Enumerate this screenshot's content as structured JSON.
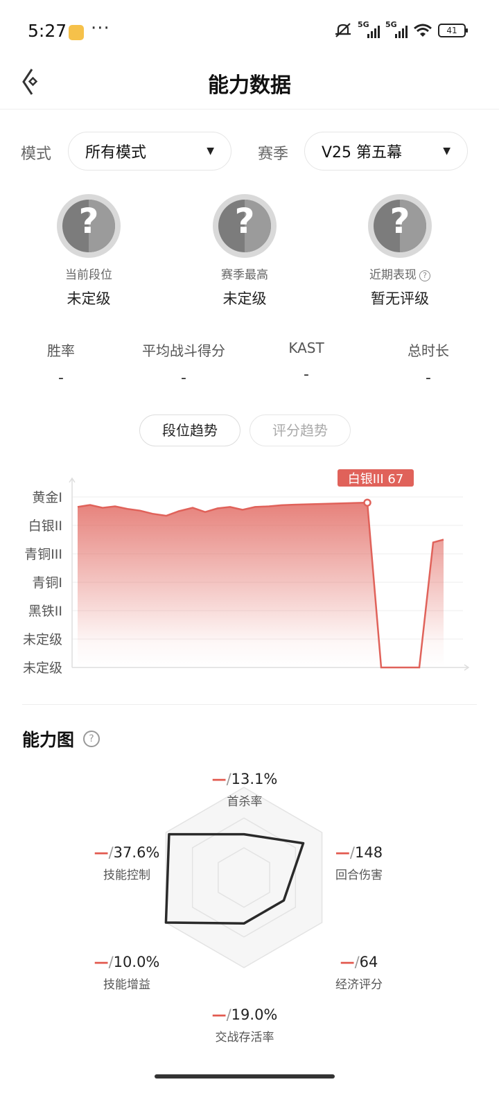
{
  "status_bar": {
    "time": "5:27",
    "dots": "···",
    "network1": "5G",
    "network2": "5G",
    "battery": "41"
  },
  "header": {
    "title": "能力数据"
  },
  "filters": {
    "mode_label": "模式",
    "mode_value": "所有模式",
    "season_label": "赛季",
    "season_value": "V25 第五幕"
  },
  "ranks": [
    {
      "label": "当前段位",
      "value": "未定级"
    },
    {
      "label": "赛季最高",
      "value": "未定级"
    },
    {
      "label": "近期表现",
      "value": "暂无评级"
    }
  ],
  "badge_symbol": "?",
  "stats": [
    {
      "label": "胜率",
      "value": "-"
    },
    {
      "label": "平均战斗得分",
      "value": "-"
    },
    {
      "label": "KAST",
      "value": "-"
    },
    {
      "label": "总时长",
      "value": "-"
    }
  ],
  "tabs": {
    "rank_trend": "段位趋势",
    "score_trend": "评分趋势"
  },
  "chart_data": {
    "type": "area",
    "yticks": [
      "黄金I",
      "白银II",
      "青铜III",
      "青铜I",
      "黑铁II",
      "未定级",
      "未定级"
    ],
    "y_levels_top_to_bottom": 7,
    "series": [
      {
        "values": [
          5.65,
          5.72,
          5.62,
          5.67,
          5.58,
          5.52,
          5.41,
          5.34,
          5.5,
          5.62,
          5.47,
          5.6,
          5.65,
          5.55,
          5.65,
          5.67,
          5.71,
          5.73,
          5.8,
          0,
          0,
          4.4,
          4.5
        ]
      }
    ],
    "tooltip": "白银III 67",
    "color": "#e0625a"
  },
  "ability": {
    "title": "能力图",
    "help_symbol": "?",
    "items": [
      {
        "name": "首杀率",
        "value": "13.1%"
      },
      {
        "name": "回合伤害",
        "value": "148"
      },
      {
        "name": "经济评分",
        "value": "64"
      },
      {
        "name": "交战存活率",
        "value": "19.0%"
      },
      {
        "name": "技能增益",
        "value": "10.0%"
      },
      {
        "name": "技能控制",
        "value": "37.6%"
      }
    ],
    "levels": [
      0.48,
      0.76,
      0.51,
      0.51,
      1.0,
      0.96
    ],
    "change_mark": "—",
    "separator": "/"
  }
}
